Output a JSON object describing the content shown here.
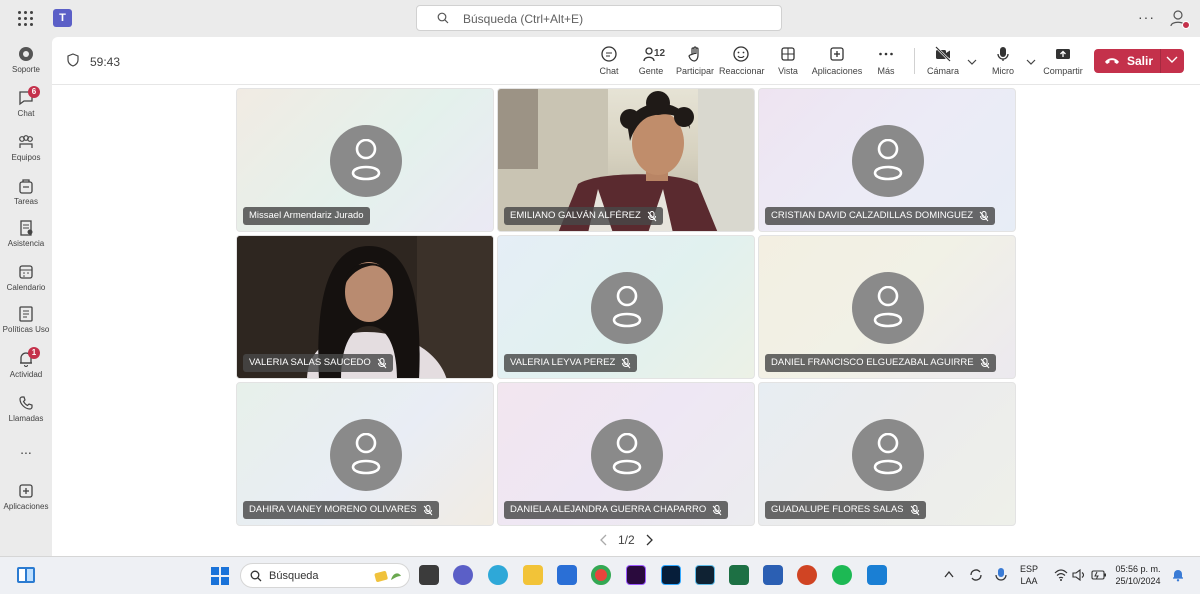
{
  "topbar": {
    "search_placeholder": "Búsqueda (Ctrl+Alt+E)",
    "app_logo": "T"
  },
  "rail": {
    "items": [
      {
        "label": "Soporte",
        "icon": "support-icon"
      },
      {
        "label": "Chat",
        "icon": "chat-icon",
        "badge": "6"
      },
      {
        "label": "Equipos",
        "icon": "teams-icon"
      },
      {
        "label": "Tareas",
        "icon": "tasks-icon"
      },
      {
        "label": "Asistencia",
        "icon": "attendance-icon"
      },
      {
        "label": "Calendario",
        "icon": "calendar-icon"
      },
      {
        "label": "Políticas Uso",
        "icon": "policies-icon"
      },
      {
        "label": "Actividad",
        "icon": "bell-icon",
        "badge": "1"
      },
      {
        "label": "Llamadas",
        "icon": "phone-icon"
      },
      {
        "label": "...",
        "icon": "more-icon"
      },
      {
        "label": "Aplicaciones",
        "icon": "add-apps-icon"
      }
    ]
  },
  "meeting": {
    "timer": "59:43",
    "toolbar": {
      "chat": "Chat",
      "people": "Gente",
      "people_count": "12",
      "raise": "Participar",
      "react": "Reaccionar",
      "view": "Vista",
      "apps": "Aplicaciones",
      "more": "Más",
      "camera": "Cámara",
      "mic": "Micro",
      "share": "Compartir",
      "leave": "Salir"
    },
    "participants": [
      {
        "name": "Missael Armendariz Jurado",
        "muted": false,
        "video": false
      },
      {
        "name": "EMILIANO GALVÁN ALFÉREZ",
        "muted": true,
        "video": true
      },
      {
        "name": "CRISTIAN DAVID CALZADILLAS DOMINGUEZ",
        "muted": true,
        "video": false
      },
      {
        "name": "VALERIA SALAS SAUCEDO",
        "muted": true,
        "video": true
      },
      {
        "name": "VALERIA LEYVA PEREZ",
        "muted": true,
        "video": false
      },
      {
        "name": "DANIEL FRANCISCO ELGUEZABAL AGUIRRE",
        "muted": true,
        "video": false
      },
      {
        "name": "DAHIRA VIANEY MORENO OLIVARES",
        "muted": true,
        "video": false
      },
      {
        "name": "DANIELA ALEJANDRA GUERRA CHAPARRO",
        "muted": true,
        "video": false
      },
      {
        "name": "GUADALUPE FLORES SALAS",
        "muted": true,
        "video": false
      }
    ],
    "pager": "1/2"
  },
  "taskbar": {
    "search_placeholder": "Búsqueda",
    "language_line1": "ESP",
    "language_line2": "LAA",
    "time": "05:56 p. m.",
    "date": "25/10/2024",
    "colors": {
      "accent": "#5b5fc7",
      "leave": "#c4314b",
      "badge": "#c4314b"
    }
  }
}
